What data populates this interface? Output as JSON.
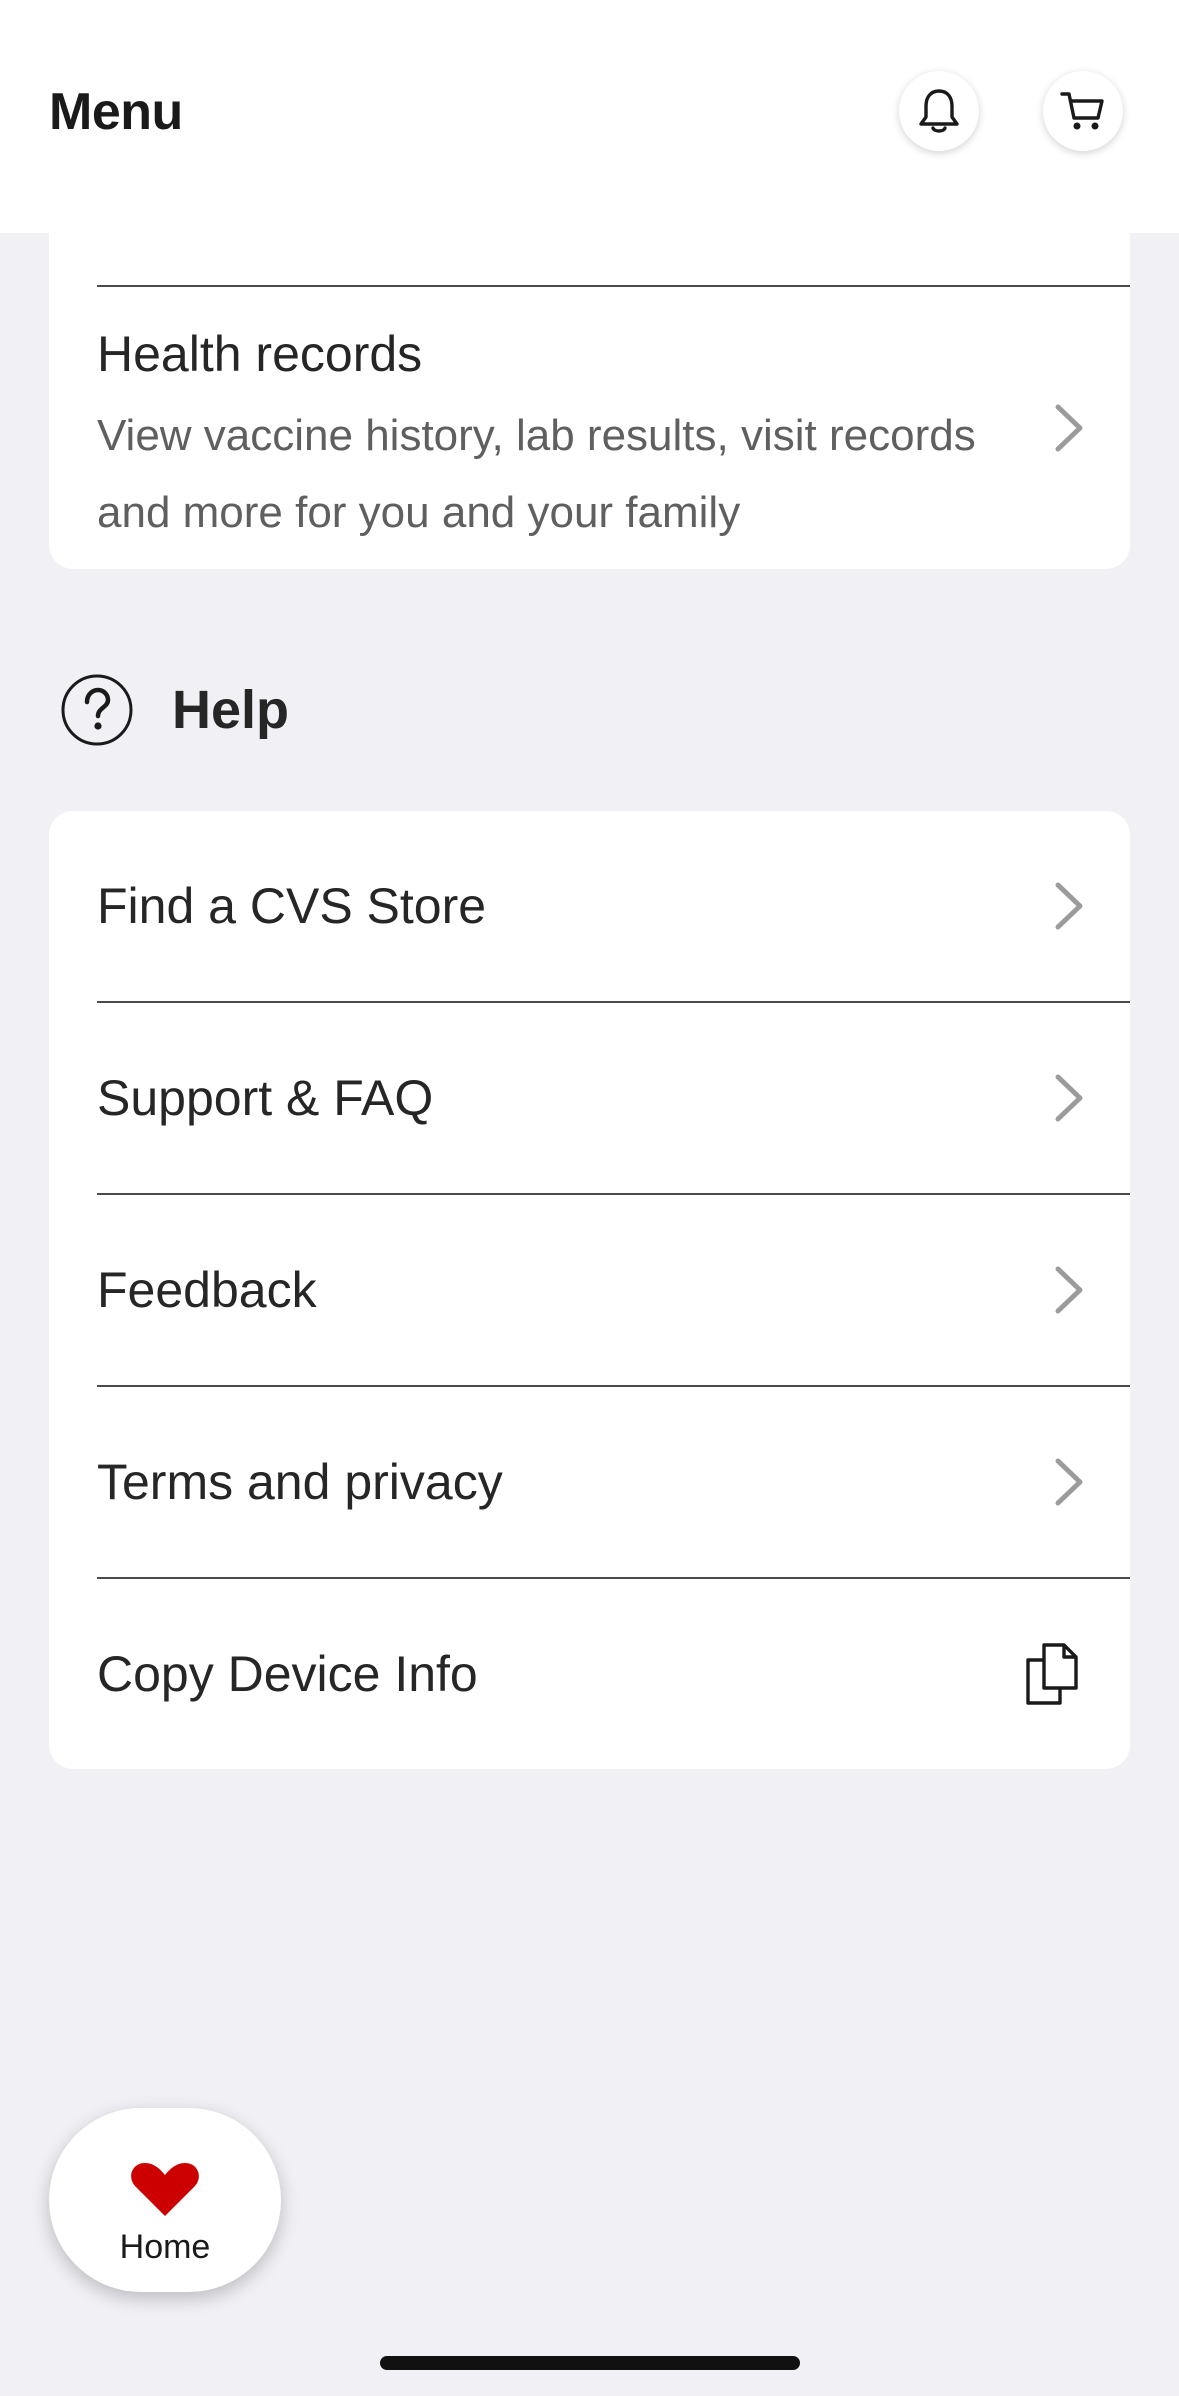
{
  "header": {
    "title": "Menu",
    "bell_icon": "bell-icon",
    "cart_icon": "cart-icon"
  },
  "health_records": {
    "title": "Health records",
    "description": "View vaccine history, lab results, visit records and more for you and your family"
  },
  "help": {
    "title": "Help",
    "icon": "question-circle-icon",
    "items": [
      {
        "label": "Find a CVS Store",
        "icon": "chevron-right-icon"
      },
      {
        "label": "Support & FAQ",
        "icon": "chevron-right-icon"
      },
      {
        "label": "Feedback",
        "icon": "chevron-right-icon"
      },
      {
        "label": "Terms and privacy",
        "icon": "chevron-right-icon"
      },
      {
        "label": "Copy Device Info",
        "icon": "copy-icon"
      }
    ]
  },
  "home_button": {
    "label": "Home",
    "icon": "heart-icon"
  },
  "colors": {
    "background": "#F0F0F5",
    "card": "#FFFFFF",
    "brand_red": "#CC0000",
    "chevron": "#9B9B9B"
  }
}
